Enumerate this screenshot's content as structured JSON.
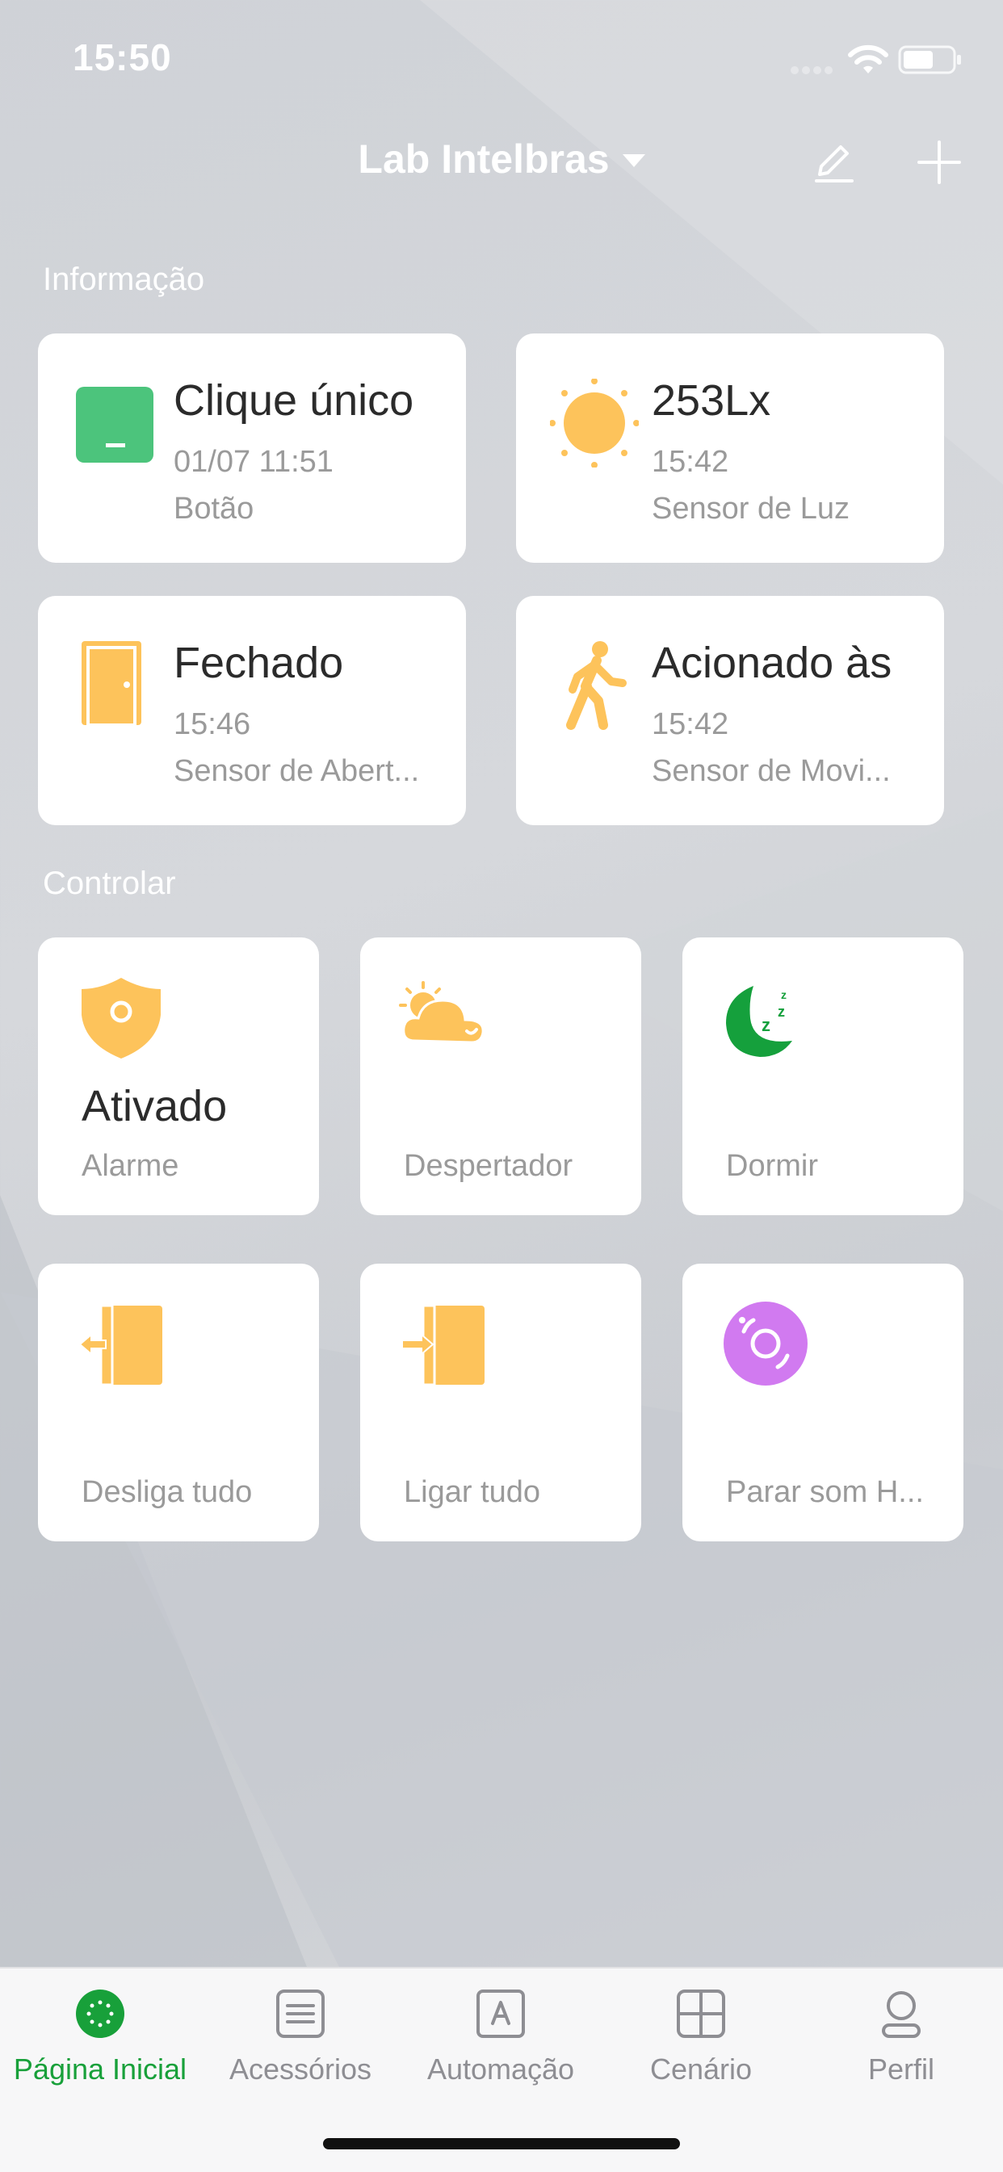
{
  "status": {
    "time": "15:50"
  },
  "header": {
    "title": "Lab Intelbras"
  },
  "sections": {
    "info": "Informação",
    "control": "Controlar"
  },
  "info_cards": [
    {
      "title": "Clique único",
      "line2": "01/07 11:51",
      "line3": "Botão",
      "icon": "button-icon"
    },
    {
      "title": "253Lx",
      "line2": "15:42",
      "line3": "Sensor de Luz",
      "icon": "sun-icon"
    },
    {
      "title": "Fechado",
      "line2": "15:46",
      "line3": "Sensor de Abert...",
      "icon": "door-icon"
    },
    {
      "title": "Acionado às",
      "line2": "15:42",
      "line3": "Sensor de Movi...",
      "icon": "walking-person-icon"
    }
  ],
  "control_cards": [
    {
      "state": "Ativado",
      "label": "Alarme",
      "icon": "shield-icon"
    },
    {
      "state": "",
      "label": "Despertador",
      "icon": "sun-cloud-icon"
    },
    {
      "state": "",
      "label": "Dormir",
      "icon": "moon-sleep-icon"
    },
    {
      "state": "",
      "label": "Desliga tudo",
      "icon": "exit-door-icon"
    },
    {
      "state": "",
      "label": "Ligar tudo",
      "icon": "enter-door-icon"
    },
    {
      "state": "",
      "label": "Parar som H...",
      "icon": "speaker-disc-icon"
    }
  ],
  "tabs": [
    {
      "label": "Página Inicial",
      "active": true
    },
    {
      "label": "Acessórios"
    },
    {
      "label": "Automação"
    },
    {
      "label": "Cenário"
    },
    {
      "label": "Perfil"
    }
  ],
  "colors": {
    "accent_green": "#18a03a",
    "icon_yellow": "#fdc35b",
    "button_green": "#4cc47c",
    "moon_green": "#15a03c",
    "speaker_purple": "#d17af0"
  }
}
